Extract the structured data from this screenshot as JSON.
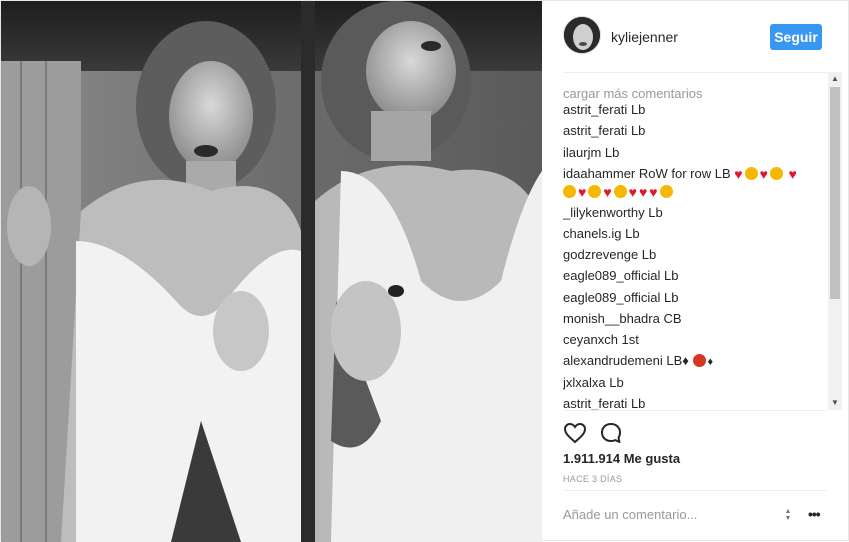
{
  "post": {
    "username": "kyliejenner",
    "follow_label": "Seguir",
    "load_more": "cargar más comentarios",
    "comments": [
      {
        "author": "astrit_ferati",
        "text": "Lb"
      },
      {
        "author": "astrit_ferati",
        "text": "Lb"
      },
      {
        "author": "ilaurjm",
        "text": "Lb"
      },
      {
        "author": "idaahammer",
        "text": "RoW for row LB"
      },
      {
        "author": "_lilykenworthy",
        "text": "Lb"
      },
      {
        "author": "chanels.ig",
        "text": "Lb"
      },
      {
        "author": "godzrevenge",
        "text": "Lb"
      },
      {
        "author": "eagle089_official",
        "text": "Lb"
      },
      {
        "author": "eagle089_official",
        "text": "Lb"
      },
      {
        "author": "monish__bhadra",
        "text": "CB"
      },
      {
        "author": "ceyanxch",
        "text": "1st"
      },
      {
        "author": "alexandrudemeni",
        "text": "LB♦"
      },
      {
        "author": "jxlxalxa",
        "text": "Lb"
      },
      {
        "author": "astrit_ferati",
        "text": "Lb"
      }
    ],
    "likes": "1.911.914 Me gusta",
    "time_ago": "HACE 3 DÍAS",
    "add_comment_placeholder": "Añade un comentario...",
    "more_label": "•••"
  },
  "icons": {
    "like": "heart-outline-icon",
    "comment": "speech-bubble-icon",
    "more": "more-options-icon"
  },
  "colors": {
    "follow_button": "#3897f0",
    "text": "#262626",
    "muted": "#999999"
  }
}
